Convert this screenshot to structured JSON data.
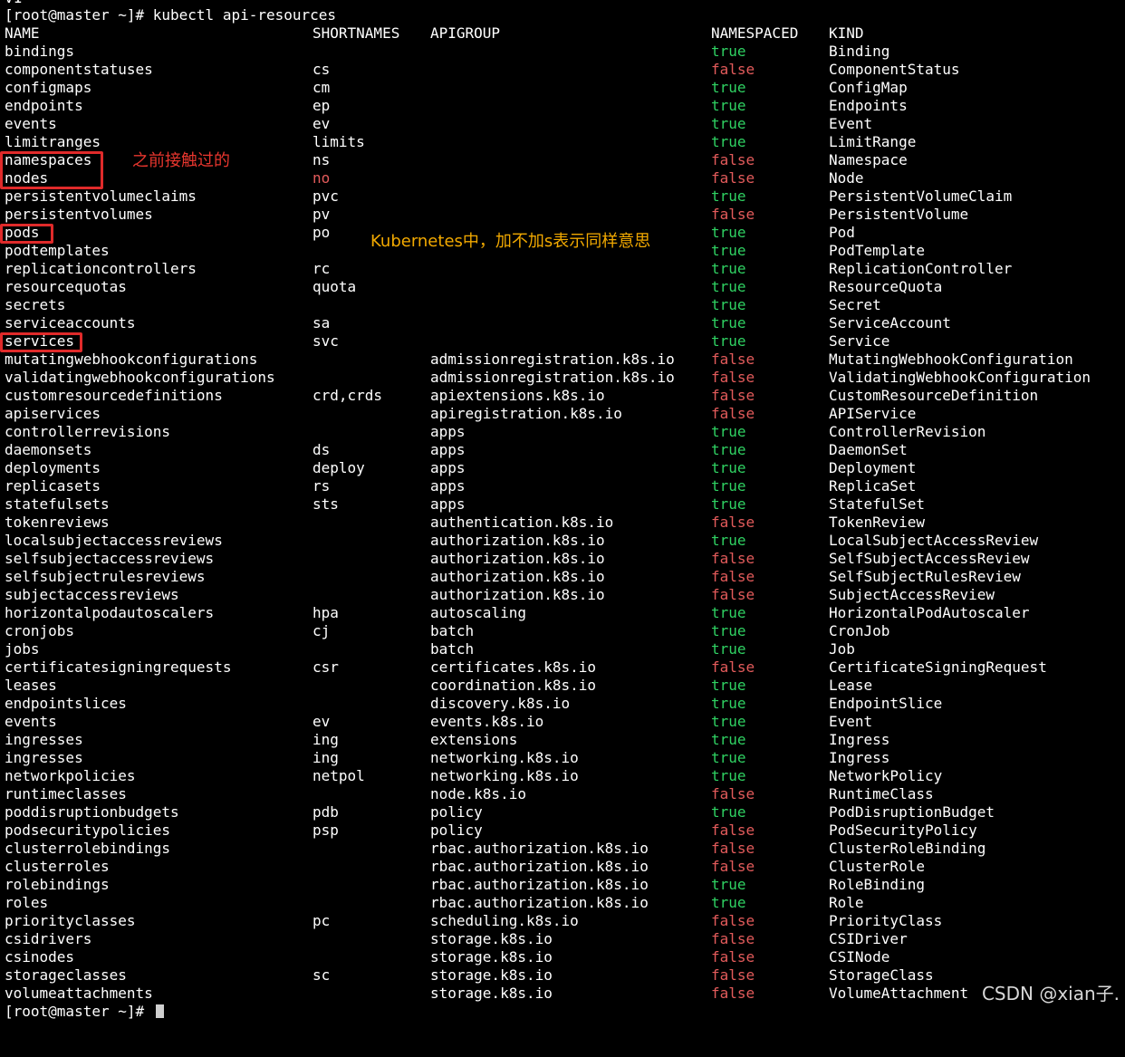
{
  "terminal": {
    "top_fragment": "v1",
    "prompt": "[root@master ~]# kubectl api-resources",
    "final_prompt": "[root@master ~]# ",
    "headers": {
      "name": "NAME",
      "shortnames": "SHORTNAMES",
      "apigroup": "APIGROUP",
      "namespaced": "NAMESPACED",
      "kind": "KIND"
    },
    "rows": [
      {
        "name": "bindings",
        "short": "",
        "group": "",
        "ns": "true",
        "kind": "Binding"
      },
      {
        "name": "componentstatuses",
        "short": "cs",
        "group": "",
        "ns": "false",
        "kind": "ComponentStatus"
      },
      {
        "name": "configmaps",
        "short": "cm",
        "group": "",
        "ns": "true",
        "kind": "ConfigMap"
      },
      {
        "name": "endpoints",
        "short": "ep",
        "group": "",
        "ns": "true",
        "kind": "Endpoints"
      },
      {
        "name": "events",
        "short": "ev",
        "group": "",
        "ns": "true",
        "kind": "Event"
      },
      {
        "name": "limitranges",
        "short": "limits",
        "group": "",
        "ns": "true",
        "kind": "LimitRange"
      },
      {
        "name": "namespaces",
        "short": "ns",
        "group": "",
        "ns": "false",
        "kind": "Namespace"
      },
      {
        "name": "nodes",
        "short": "no",
        "group": "",
        "ns": "false",
        "kind": "Node",
        "short_red": true
      },
      {
        "name": "persistentvolumeclaims",
        "short": "pvc",
        "group": "",
        "ns": "true",
        "kind": "PersistentVolumeClaim"
      },
      {
        "name": "persistentvolumes",
        "short": "pv",
        "group": "",
        "ns": "false",
        "kind": "PersistentVolume"
      },
      {
        "name": "pods",
        "short": "po",
        "group": "",
        "ns": "true",
        "kind": "Pod"
      },
      {
        "name": "podtemplates",
        "short": "",
        "group": "",
        "ns": "true",
        "kind": "PodTemplate"
      },
      {
        "name": "replicationcontrollers",
        "short": "rc",
        "group": "",
        "ns": "true",
        "kind": "ReplicationController"
      },
      {
        "name": "resourcequotas",
        "short": "quota",
        "group": "",
        "ns": "true",
        "kind": "ResourceQuota"
      },
      {
        "name": "secrets",
        "short": "",
        "group": "",
        "ns": "true",
        "kind": "Secret"
      },
      {
        "name": "serviceaccounts",
        "short": "sa",
        "group": "",
        "ns": "true",
        "kind": "ServiceAccount"
      },
      {
        "name": "services",
        "short": "svc",
        "group": "",
        "ns": "true",
        "kind": "Service"
      },
      {
        "name": "mutatingwebhookconfigurations",
        "short": "",
        "group": "admissionregistration.k8s.io",
        "ns": "false",
        "kind": "MutatingWebhookConfiguration"
      },
      {
        "name": "validatingwebhookconfigurations",
        "short": "",
        "group": "admissionregistration.k8s.io",
        "ns": "false",
        "kind": "ValidatingWebhookConfiguration"
      },
      {
        "name": "customresourcedefinitions",
        "short": "crd,crds",
        "group": "apiextensions.k8s.io",
        "ns": "false",
        "kind": "CustomResourceDefinition"
      },
      {
        "name": "apiservices",
        "short": "",
        "group": "apiregistration.k8s.io",
        "ns": "false",
        "kind": "APIService"
      },
      {
        "name": "controllerrevisions",
        "short": "",
        "group": "apps",
        "ns": "true",
        "kind": "ControllerRevision"
      },
      {
        "name": "daemonsets",
        "short": "ds",
        "group": "apps",
        "ns": "true",
        "kind": "DaemonSet"
      },
      {
        "name": "deployments",
        "short": "deploy",
        "group": "apps",
        "ns": "true",
        "kind": "Deployment"
      },
      {
        "name": "replicasets",
        "short": "rs",
        "group": "apps",
        "ns": "true",
        "kind": "ReplicaSet"
      },
      {
        "name": "statefulsets",
        "short": "sts",
        "group": "apps",
        "ns": "true",
        "kind": "StatefulSet"
      },
      {
        "name": "tokenreviews",
        "short": "",
        "group": "authentication.k8s.io",
        "ns": "false",
        "kind": "TokenReview"
      },
      {
        "name": "localsubjectaccessreviews",
        "short": "",
        "group": "authorization.k8s.io",
        "ns": "true",
        "kind": "LocalSubjectAccessReview"
      },
      {
        "name": "selfsubjectaccessreviews",
        "short": "",
        "group": "authorization.k8s.io",
        "ns": "false",
        "kind": "SelfSubjectAccessReview"
      },
      {
        "name": "selfsubjectrulesreviews",
        "short": "",
        "group": "authorization.k8s.io",
        "ns": "false",
        "kind": "SelfSubjectRulesReview"
      },
      {
        "name": "subjectaccessreviews",
        "short": "",
        "group": "authorization.k8s.io",
        "ns": "false",
        "kind": "SubjectAccessReview"
      },
      {
        "name": "horizontalpodautoscalers",
        "short": "hpa",
        "group": "autoscaling",
        "ns": "true",
        "kind": "HorizontalPodAutoscaler"
      },
      {
        "name": "cronjobs",
        "short": "cj",
        "group": "batch",
        "ns": "true",
        "kind": "CronJob"
      },
      {
        "name": "jobs",
        "short": "",
        "group": "batch",
        "ns": "true",
        "kind": "Job"
      },
      {
        "name": "certificatesigningrequests",
        "short": "csr",
        "group": "certificates.k8s.io",
        "ns": "false",
        "kind": "CertificateSigningRequest"
      },
      {
        "name": "leases",
        "short": "",
        "group": "coordination.k8s.io",
        "ns": "true",
        "kind": "Lease"
      },
      {
        "name": "endpointslices",
        "short": "",
        "group": "discovery.k8s.io",
        "ns": "true",
        "kind": "EndpointSlice"
      },
      {
        "name": "events",
        "short": "ev",
        "group": "events.k8s.io",
        "ns": "true",
        "kind": "Event"
      },
      {
        "name": "ingresses",
        "short": "ing",
        "group": "extensions",
        "ns": "true",
        "kind": "Ingress"
      },
      {
        "name": "ingresses",
        "short": "ing",
        "group": "networking.k8s.io",
        "ns": "true",
        "kind": "Ingress"
      },
      {
        "name": "networkpolicies",
        "short": "netpol",
        "group": "networking.k8s.io",
        "ns": "true",
        "kind": "NetworkPolicy"
      },
      {
        "name": "runtimeclasses",
        "short": "",
        "group": "node.k8s.io",
        "ns": "false",
        "kind": "RuntimeClass"
      },
      {
        "name": "poddisruptionbudgets",
        "short": "pdb",
        "group": "policy",
        "ns": "true",
        "kind": "PodDisruptionBudget"
      },
      {
        "name": "podsecuritypolicies",
        "short": "psp",
        "group": "policy",
        "ns": "false",
        "kind": "PodSecurityPolicy"
      },
      {
        "name": "clusterrolebindings",
        "short": "",
        "group": "rbac.authorization.k8s.io",
        "ns": "false",
        "kind": "ClusterRoleBinding"
      },
      {
        "name": "clusterroles",
        "short": "",
        "group": "rbac.authorization.k8s.io",
        "ns": "false",
        "kind": "ClusterRole"
      },
      {
        "name": "rolebindings",
        "short": "",
        "group": "rbac.authorization.k8s.io",
        "ns": "true",
        "kind": "RoleBinding"
      },
      {
        "name": "roles",
        "short": "",
        "group": "rbac.authorization.k8s.io",
        "ns": "true",
        "kind": "Role"
      },
      {
        "name": "priorityclasses",
        "short": "pc",
        "group": "scheduling.k8s.io",
        "ns": "false",
        "kind": "PriorityClass"
      },
      {
        "name": "csidrivers",
        "short": "",
        "group": "storage.k8s.io",
        "ns": "false",
        "kind": "CSIDriver"
      },
      {
        "name": "csinodes",
        "short": "",
        "group": "storage.k8s.io",
        "ns": "false",
        "kind": "CSINode"
      },
      {
        "name": "storageclasses",
        "short": "sc",
        "group": "storage.k8s.io",
        "ns": "false",
        "kind": "StorageClass"
      },
      {
        "name": "volumeattachments",
        "short": "",
        "group": "storage.k8s.io",
        "ns": "false",
        "kind": "VolumeAttachment"
      }
    ]
  },
  "annotations": {
    "previously_seen": "之前接触过的",
    "plural_note": "Kubernetes中，加不加s表示同样意思"
  },
  "watermark": "CSDN @xian子.",
  "colors": {
    "background": "#000000",
    "text": "#ffffff",
    "true": "#2fd162",
    "false": "#e35b5b",
    "highlight_box": "#e02a2a",
    "annotation_red": "#e8362e",
    "annotation_orange": "#f2a900"
  }
}
